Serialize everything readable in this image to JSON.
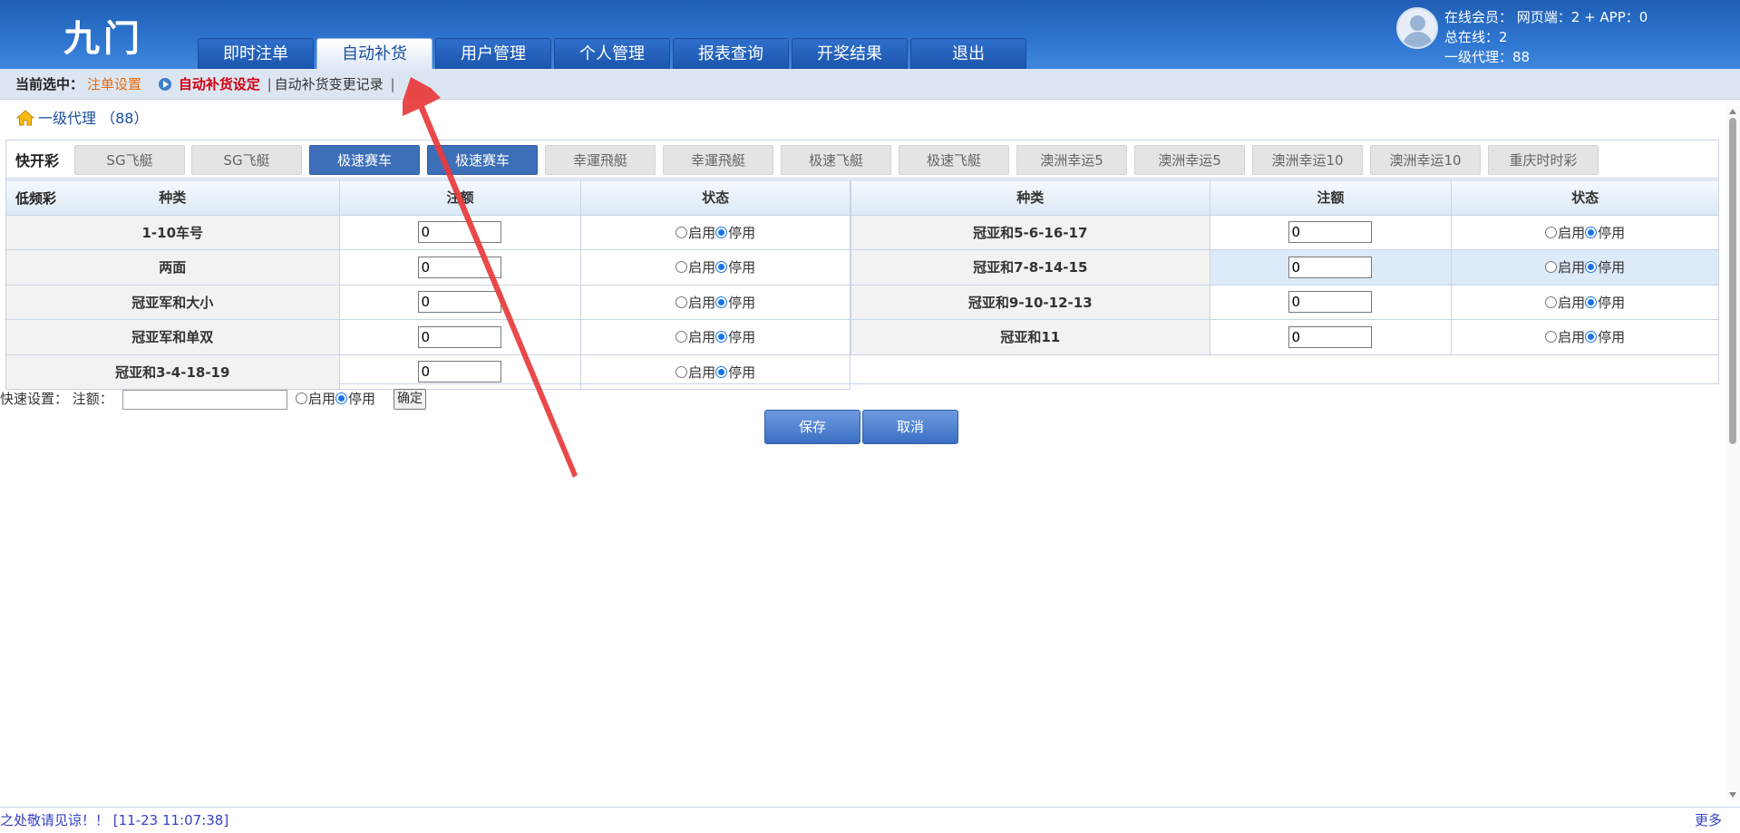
{
  "header": {
    "logo": "九门",
    "nav_tabs": [
      {
        "label": "即时注单",
        "active": false
      },
      {
        "label": "自动补货",
        "active": true
      },
      {
        "label": "用户管理",
        "active": false
      },
      {
        "label": "个人管理",
        "active": false
      },
      {
        "label": "报表查询",
        "active": false
      },
      {
        "label": "开奖结果",
        "active": false
      },
      {
        "label": "退出",
        "active": false
      }
    ],
    "online": {
      "line1": "在线会员： 网页端：2 + APP：0",
      "line2": "总在线：2",
      "line3": "一级代理：88"
    }
  },
  "breadcrumb": {
    "label": "当前选中：",
    "section": "注单设置",
    "current": "自动补货设定",
    "separator": "|",
    "link": "自动补货变更记录",
    "trailing": "|"
  },
  "agent": {
    "text": "一级代理 （88）"
  },
  "games": {
    "category": "快开彩",
    "tabs": [
      {
        "label": "SG飞艇",
        "active": false
      },
      {
        "label": "SG飞艇",
        "active": false
      },
      {
        "label": "极速赛车",
        "active": true
      },
      {
        "label": "极速赛车",
        "active": true
      },
      {
        "label": "幸運飛艇",
        "active": false
      },
      {
        "label": "幸運飛艇",
        "active": false
      },
      {
        "label": "极速飞艇",
        "active": false
      },
      {
        "label": "极速飞艇",
        "active": false
      },
      {
        "label": "澳洲幸运5",
        "active": false
      },
      {
        "label": "澳洲幸运5",
        "active": false
      },
      {
        "label": "澳洲幸运10",
        "active": false
      },
      {
        "label": "澳洲幸运10",
        "active": false
      },
      {
        "label": "重庆时时彩",
        "active": false
      }
    ]
  },
  "table": {
    "lowfreq_label": "低频彩",
    "headers": {
      "kind": "种类",
      "amount": "注额",
      "status": "状态"
    },
    "radio_on_label": "启用",
    "radio_off_label": "停用",
    "left_rows": [
      {
        "kind": "1-10车号",
        "amount": "0"
      },
      {
        "kind": "两面",
        "amount": "0"
      },
      {
        "kind": "冠亚军和大小",
        "amount": "0"
      },
      {
        "kind": "冠亚军和单双",
        "amount": "0"
      },
      {
        "kind": "冠亚和3-4-18-19",
        "amount": "0"
      }
    ],
    "right_rows": [
      {
        "kind": "冠亚和5-6-16-17",
        "amount": "0"
      },
      {
        "kind": "冠亚和7-8-14-15",
        "amount": "0"
      },
      {
        "kind": "冠亚和9-10-12-13",
        "amount": "0"
      },
      {
        "kind": "冠亚和11",
        "amount": "0"
      }
    ]
  },
  "quick": {
    "label": "快速设置：  注额：",
    "amount": "",
    "on_label": "启用",
    "off_label": "停用",
    "confirm": "确定"
  },
  "actions": {
    "save": "保存",
    "cancel": "取消"
  },
  "footer": {
    "marquee": "之处敬请见谅！！ [11-23 11:07:38]",
    "more": "更多"
  },
  "colors": {
    "header_blue": "#2d74cf",
    "active_game_tab": "#3d6fb8",
    "annotation_arrow": "#e8393a"
  }
}
